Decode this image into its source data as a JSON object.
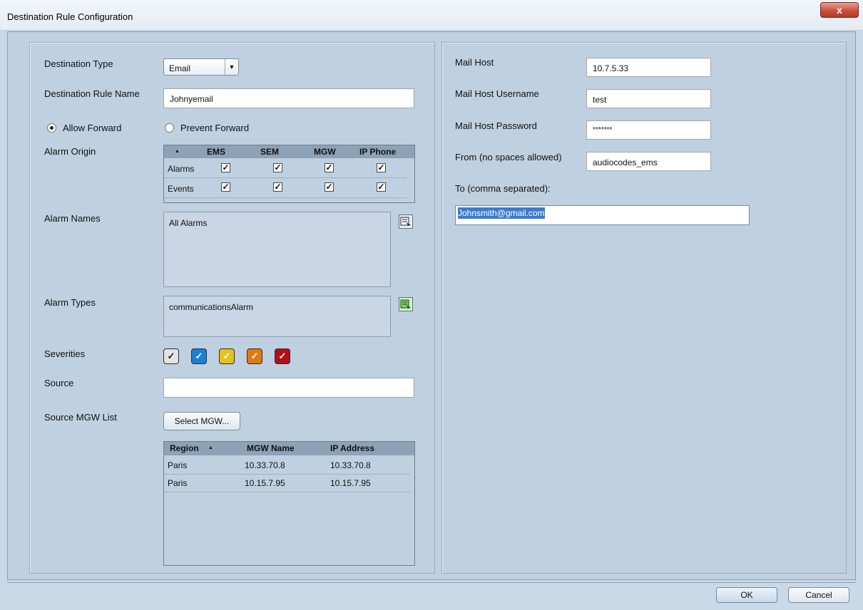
{
  "window": {
    "title": "Destination Rule Configuration",
    "close_label": "x"
  },
  "left": {
    "destination_type": {
      "label": "Destination Type",
      "value": "Email"
    },
    "rule_name": {
      "label": "Destination Rule Name",
      "value": "Johnyemail"
    },
    "forward": {
      "allow_label": "Allow Forward",
      "prevent_label": "Prevent Forward",
      "selected": "allow"
    },
    "alarm_origin": {
      "label": "Alarm Origin",
      "sort_glyph": "▲",
      "columns": [
        "EMS",
        "SEM",
        "MGW",
        "IP Phone"
      ],
      "rows": [
        {
          "name": "Alarms",
          "checks": [
            true,
            true,
            true,
            true
          ]
        },
        {
          "name": "Events",
          "checks": [
            true,
            true,
            true,
            true
          ]
        }
      ]
    },
    "alarm_names": {
      "label": "Alarm Names",
      "value": "All Alarms"
    },
    "alarm_types": {
      "label": "Alarm Types",
      "value": "communicationsAlarm"
    },
    "severities": {
      "label": "Severities",
      "items": [
        {
          "name": "indeterminate",
          "color": "#e4e4e4"
        },
        {
          "name": "warning",
          "color": "#1e7fd6"
        },
        {
          "name": "minor",
          "color": "#e8c21c"
        },
        {
          "name": "major",
          "color": "#e07a14"
        },
        {
          "name": "critical",
          "color": "#b01018"
        }
      ]
    },
    "source": {
      "label": "Source",
      "value": ""
    },
    "source_mgw": {
      "label": "Source MGW List",
      "button": "Select MGW...",
      "columns": [
        "Region",
        "MGW Name",
        "IP Address"
      ],
      "sort_glyph": "▲",
      "rows": [
        [
          "Paris",
          "10.33.70.8",
          "10.33.70.8"
        ],
        [
          "Paris",
          "10.15.7.95",
          "10.15.7.95"
        ]
      ]
    }
  },
  "right": {
    "mail_host": {
      "label": "Mail Host",
      "value": "10.7.5.33"
    },
    "username": {
      "label": "Mail Host Username",
      "value": "test"
    },
    "password": {
      "label": "Mail Host Password",
      "value": "*******"
    },
    "from": {
      "label": "From (no spaces allowed)",
      "value": "audiocodes_ems"
    },
    "to": {
      "label": "To (comma separated):",
      "value": "Johnsmith@gmail.com"
    }
  },
  "footer": {
    "ok": "OK",
    "cancel": "Cancel"
  }
}
